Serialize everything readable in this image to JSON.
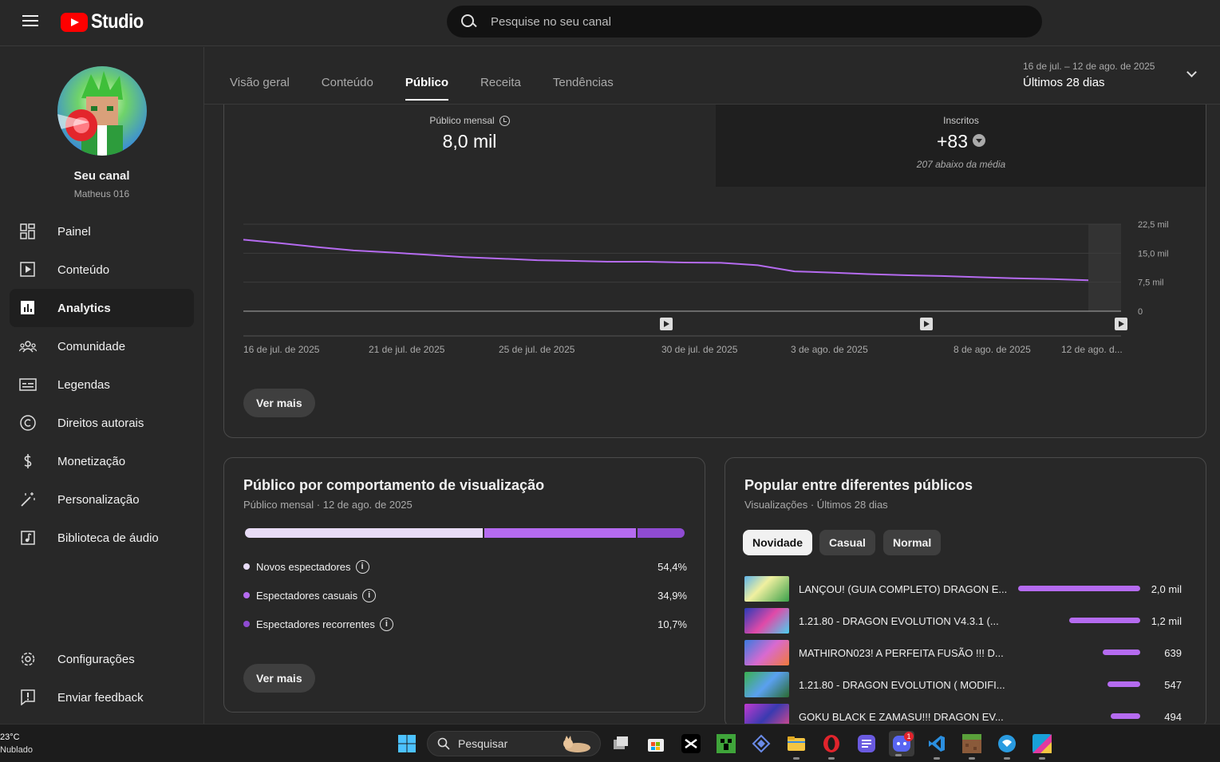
{
  "header": {
    "app_name": "Studio",
    "search_placeholder": "Pesquise no seu canal"
  },
  "sidebar": {
    "channel_title": "Seu canal",
    "channel_handle": "Matheus 016",
    "items": [
      {
        "label": "Painel",
        "icon": "dashboard-icon",
        "active": false
      },
      {
        "label": "Conteúdo",
        "icon": "content-icon",
        "active": false
      },
      {
        "label": "Analytics",
        "icon": "analytics-icon",
        "active": true
      },
      {
        "label": "Comunidade",
        "icon": "community-icon",
        "active": false
      },
      {
        "label": "Legendas",
        "icon": "subtitles-icon",
        "active": false
      },
      {
        "label": "Direitos autorais",
        "icon": "copyright-icon",
        "active": false
      },
      {
        "label": "Monetização",
        "icon": "monetization-icon",
        "active": false
      },
      {
        "label": "Personalização",
        "icon": "customization-icon",
        "active": false
      },
      {
        "label": "Biblioteca de áudio",
        "icon": "audio-library-icon",
        "active": false
      }
    ],
    "bottom_items": [
      {
        "label": "Configurações",
        "icon": "settings-icon"
      },
      {
        "label": "Enviar feedback",
        "icon": "feedback-icon"
      }
    ]
  },
  "tabs": [
    "Visão geral",
    "Conteúdo",
    "Público",
    "Receita",
    "Tendências"
  ],
  "active_tab": "Público",
  "date_range": {
    "dates": "16 de jul. – 12 de ago. de 2025",
    "label": "Últimos 28 dias"
  },
  "metrics": {
    "monthly_audience": {
      "label": "Público mensal",
      "value": "8,0 mil"
    },
    "subscribers": {
      "label": "Inscritos",
      "value": "+83",
      "note": "207 abaixo da média"
    }
  },
  "chart_data": {
    "type": "line",
    "x": [
      "16 de jul. de 2025",
      "21 de jul. de 2025",
      "25 de jul. de 2025",
      "30 de jul. de 2025",
      "3 de ago. de 2025",
      "8 de ago. de 2025",
      "12 de ago. d..."
    ],
    "y_ticks": [
      "22,5 mil",
      "15,0 mil",
      "7,5 mil",
      "0"
    ],
    "ylim": [
      0,
      22500
    ],
    "series": [
      {
        "values": [
          18500,
          17600,
          16600,
          15700,
          15200,
          14600,
          14000,
          13600,
          13200,
          13000,
          12800,
          12800,
          12600,
          12500,
          11900,
          10300,
          10000,
          9600,
          9300,
          9100,
          8800,
          8500,
          8300,
          8000
        ]
      }
    ],
    "grid": true
  },
  "buttons": {
    "see_more": "Ver mais"
  },
  "behavior_card": {
    "title": "Público por comportamento de visualização",
    "subtitle": "Público mensal · 12 de ago. de 2025",
    "segments": [
      {
        "label": "Novos espectadores",
        "value": "54,4%",
        "fraction": 0.544,
        "color": "#e8dcf6"
      },
      {
        "label": "Espectadores casuais",
        "value": "34,9%",
        "fraction": 0.349,
        "color": "#b56bf0"
      },
      {
        "label": "Espectadores recorrentes",
        "value": "10,7%",
        "fraction": 0.107,
        "color": "#8f4bd2"
      }
    ]
  },
  "popular_card": {
    "title": "Popular entre diferentes públicos",
    "subtitle": "Visualizações · Últimos 28 dias",
    "chips": [
      "Novidade",
      "Casual",
      "Normal"
    ],
    "active_chip": "Novidade",
    "videos": [
      {
        "title": "LANÇOU! (GUIA COMPLETO) DRAGON E...",
        "value": "2,0 mil",
        "fraction": 1.0
      },
      {
        "title": "1.21.80 - DRAGON EVOLUTION V4.3.1 (...",
        "value": "1,2 mil",
        "fraction": 0.58
      },
      {
        "title": "MATHIRON023! A PERFEITA FUSÃO !!! D...",
        "value": "639",
        "fraction": 0.31
      },
      {
        "title": "1.21.80 - DRAGON EVOLUTION ( MODIFI...",
        "value": "547",
        "fraction": 0.27
      },
      {
        "title": "GOKU BLACK E ZAMASU!!! DRAGON EV...",
        "value": "494",
        "fraction": 0.24
      }
    ]
  },
  "taskbar": {
    "temperature": "23°C",
    "condition": "Nublado",
    "search_label": "Pesquisar",
    "discord_badge": "1"
  }
}
